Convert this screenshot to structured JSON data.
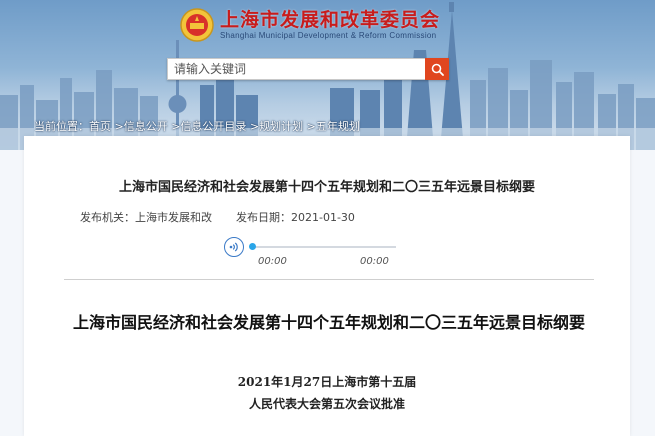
{
  "header": {
    "org_name_cn": "上海市发展和改革委员会",
    "org_name_en": "Shanghai Municipal Development & Reform Commission"
  },
  "search": {
    "placeholder": "请输入关键词",
    "button_icon": "search-icon"
  },
  "breadcrumb": {
    "items": [
      "当前位置",
      "首页",
      "信息公开",
      "信息公开目录",
      "规划计划",
      "五年规划"
    ],
    "separator": ">"
  },
  "document": {
    "title": "上海市国民经济和社会发展第十四个五年规划和二〇三五年远景目标纲要",
    "publisher_label": "发布机关：",
    "publisher": "上海市发展和改",
    "date_label": "发布日期：",
    "date": "2021-01-30"
  },
  "audio": {
    "current_time": "00:00",
    "total_time": "00:00",
    "progress": 0,
    "icon": "sound-icon"
  },
  "article": {
    "title": "上海市国民经济和社会发展第十四个五年规划和二〇三五年远景目标纲要",
    "subtitle_line1": "2021年1月27日上海市第十五届",
    "subtitle_line2": "人民代表大会第五次会议批准"
  },
  "colors": {
    "brand_red": "#c81c1c",
    "search_button": "#e0461f",
    "audio_accent": "#2aa5e8"
  }
}
